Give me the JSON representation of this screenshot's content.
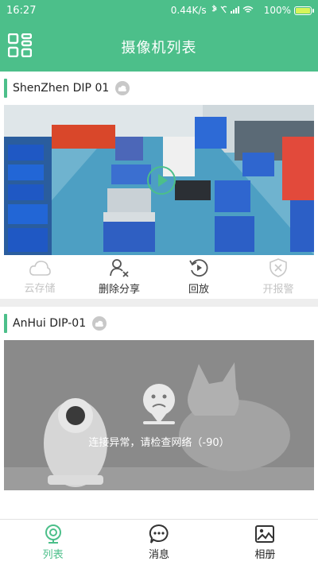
{
  "status_bar": {
    "time": "16:27",
    "speed": "0.44K/s",
    "battery": "100%"
  },
  "header": {
    "title": "摄像机列表"
  },
  "cameras": [
    {
      "name": "ShenZhen DIP 01",
      "actions": [
        {
          "label": "云存储",
          "icon": "cloud-icon",
          "enabled": false
        },
        {
          "label": "删除分享",
          "icon": "user-remove-icon",
          "enabled": true
        },
        {
          "label": "回放",
          "icon": "playback-icon",
          "enabled": true
        },
        {
          "label": "开报警",
          "icon": "shield-icon",
          "enabled": false
        }
      ]
    },
    {
      "name": "AnHui  DIP-01",
      "error": "连接异常，请检查网络（-90）"
    }
  ],
  "tabs": [
    {
      "label": "列表",
      "icon": "camera-icon",
      "active": true
    },
    {
      "label": "消息",
      "icon": "message-icon",
      "active": false
    },
    {
      "label": "相册",
      "icon": "album-icon",
      "active": false
    }
  ],
  "colors": {
    "accent": "#4cbf8a",
    "disabled": "#c4c4c4"
  }
}
